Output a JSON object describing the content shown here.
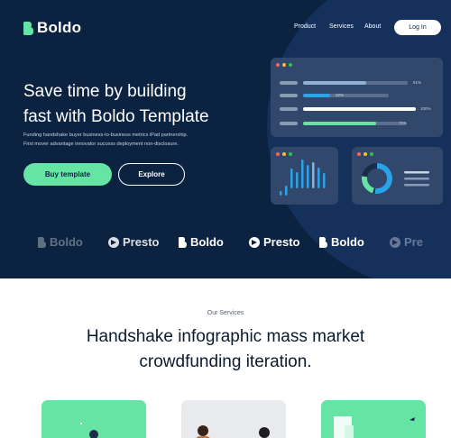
{
  "header": {
    "logo_text": "Boldo",
    "nav": [
      "Product",
      "Services",
      "About"
    ],
    "login_label": "Log In"
  },
  "hero": {
    "title_line1": "Save time by building",
    "title_line2": "fast with Boldo Template",
    "desc_line1": "Funding handshake buyer business-to-business metrics iPad partnership.",
    "desc_line2": "First mover advantage innovator success deployment non-disclosure.",
    "buy_label": "Buy template",
    "explore_label": "Explore"
  },
  "dashboard": {
    "progress": [
      {
        "value": 0.6,
        "label": "61%",
        "color": "#8fb1d6"
      },
      {
        "value": 0.32,
        "label": "32%",
        "color": "#2aa4e8"
      },
      {
        "value": 1.0,
        "label": "100%",
        "color": "#ffffff"
      },
      {
        "value": 0.71,
        "label": "71%",
        "color": "#65e4a3"
      }
    ],
    "dot_colors": [
      "#ff5f56",
      "#ffbd2e",
      "#27c93f"
    ],
    "accent": "#2aa4e8",
    "green": "#65e4a3"
  },
  "brands": [
    "Boldo",
    "Presto",
    "Boldo",
    "Presto",
    "Boldo",
    "Pre"
  ],
  "services": {
    "kicker": "Our Services",
    "title_line1": "Handshake infographic mass market",
    "title_line2": "crowdfunding iteration."
  },
  "colors": {
    "navy": "#0b2341",
    "green": "#65e4a3",
    "panel": "#31476b"
  }
}
